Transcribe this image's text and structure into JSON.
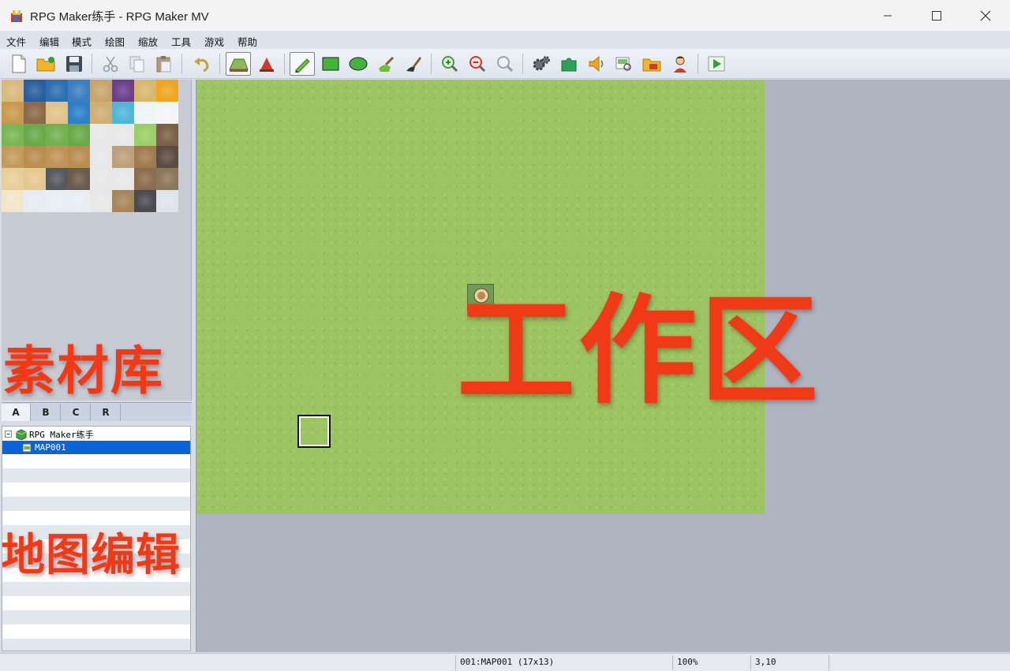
{
  "window": {
    "title": "RPG Maker练手 - RPG Maker MV",
    "minimize": "—",
    "maximize": "☐",
    "close": "✕"
  },
  "menu": [
    "文件",
    "编辑",
    "模式",
    "绘图",
    "缩放",
    "工具",
    "游戏",
    "帮助"
  ],
  "toolbar": {
    "icons": [
      "new-project-icon",
      "open-project-icon",
      "save-project-icon",
      "cut-icon",
      "copy-icon",
      "paste-icon",
      "undo-icon",
      "map-mode-icon",
      "event-mode-icon",
      "pencil-icon",
      "rectangle-icon",
      "ellipse-icon",
      "flood-fill-icon",
      "shadow-pen-icon",
      "zoom-in-icon",
      "zoom-out-icon",
      "actual-size-icon",
      "database-icon",
      "plugin-manager-icon",
      "sound-test-icon",
      "event-searcher-icon",
      "resource-manager-icon",
      "character-generator-icon",
      "playtest-icon"
    ]
  },
  "palette": {
    "label": "素材库",
    "tile_colors": [
      [
        "#d9b97e",
        "#2a5f9e",
        "#2f6eb0",
        "#3b7fc2",
        "#c9a56c",
        "#6b3f8c",
        "#d8b66f",
        "#f0a51e"
      ],
      [
        "#c99a4d",
        "#8a6a48",
        "#e2c288",
        "#2e7fc8",
        "#d0ae74",
        "#4fb6d8",
        "#eef4f8",
        "#f3f5f8"
      ],
      [
        "#7ab654",
        "#6aa84a",
        "#74b04f",
        "#6aa84a",
        "#e8e8e8",
        "#e8e8e8",
        "#9ccd68",
        "#7a6046"
      ],
      [
        "#c49a5c",
        "#b98d52",
        "#bf9357",
        "#b98d52",
        "#e8e8e8",
        "#bda07b",
        "#a17b4f",
        "#5a4c40"
      ],
      [
        "#e8cf9a",
        "#e4c98f",
        "#55585c",
        "#6a5b4d",
        "#e8e8e8",
        "#e8e8e8",
        "#8b6c4e",
        "#8b7758"
      ],
      [
        "#f3e6c8",
        "#e7ecf3",
        "#e8eef5",
        "#e8eef5",
        "#e8e8e8",
        "#a8865c",
        "#4b4a4e",
        "#dfe3ec"
      ]
    ]
  },
  "tabs": [
    "A",
    "B",
    "C",
    "R"
  ],
  "map_tree": {
    "project": "RPG Maker练手",
    "maps": [
      "MAP001"
    ],
    "label": "地图编辑"
  },
  "workarea": {
    "label": "工作区"
  },
  "status": {
    "map": "001:MAP001 (17x13)",
    "zoom": "100%",
    "coords": "3,10"
  },
  "colors": {
    "accent_selection": "#0a64d8",
    "overlay_text": "#f03a17",
    "grass": "#9cc462"
  }
}
